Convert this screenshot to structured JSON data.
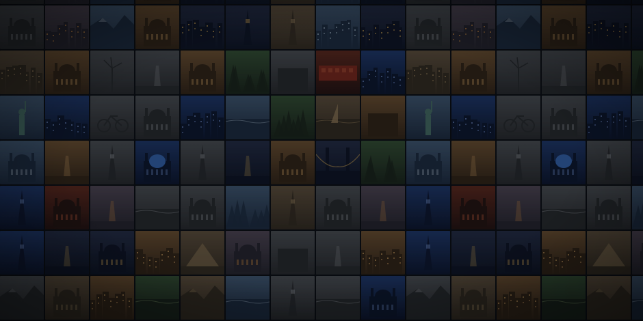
{
  "mosaic": {
    "columns": 15,
    "palette": {
      "night": [
        "#10182b",
        "#2a3350",
        "#c9a25a"
      ],
      "dusk": [
        "#2b2a35",
        "#5a5060",
        "#c88a4a"
      ],
      "sepia": [
        "#3b3227",
        "#6b5a45",
        "#a08660"
      ],
      "sky": [
        "#22324a",
        "#4a6482",
        "#9fb3c8"
      ],
      "grey": [
        "#2e3034",
        "#55595f",
        "#8c9096"
      ],
      "warm": [
        "#3a2a1c",
        "#7a5a38",
        "#d0a060"
      ],
      "green": [
        "#1e2a20",
        "#3c5a3c",
        "#7f9a6a"
      ],
      "blue": [
        "#0f1a36",
        "#24407a",
        "#6a8ac8"
      ],
      "red": [
        "#2a1614",
        "#6a2e22",
        "#c0583a"
      ]
    },
    "rows": [
      [
        {
          "subject": "dome",
          "tone": "grey"
        },
        {
          "subject": "harbor-night",
          "tone": "dusk"
        },
        {
          "subject": "mountains",
          "tone": "sky"
        },
        {
          "subject": "cathedral-night",
          "tone": "warm"
        },
        {
          "subject": "city-lights",
          "tone": "night"
        },
        {
          "subject": "tower-night",
          "tone": "night"
        },
        {
          "subject": "eiffel-tower",
          "tone": "sepia"
        },
        {
          "subject": "cloud-city",
          "tone": "sky"
        },
        {
          "subject": "canal-night",
          "tone": "night"
        },
        {
          "subject": "dome",
          "tone": "grey"
        },
        {
          "subject": "harbor-night",
          "tone": "dusk"
        },
        {
          "subject": "mountains",
          "tone": "sky"
        },
        {
          "subject": "cathedral-night",
          "tone": "warm"
        },
        {
          "subject": "city-lights",
          "tone": "night"
        },
        {
          "subject": "tower-night",
          "tone": "night"
        }
      ],
      [
        {
          "subject": "dome",
          "tone": "grey"
        },
        {
          "subject": "harbor-night",
          "tone": "dusk"
        },
        {
          "subject": "mountains",
          "tone": "sky"
        },
        {
          "subject": "cathedral-night",
          "tone": "warm"
        },
        {
          "subject": "city-lights",
          "tone": "night"
        },
        {
          "subject": "tower-night",
          "tone": "night"
        },
        {
          "subject": "eiffel-tower",
          "tone": "sepia"
        },
        {
          "subject": "cloud-city",
          "tone": "sky"
        },
        {
          "subject": "canal-night",
          "tone": "night"
        },
        {
          "subject": "dome",
          "tone": "grey"
        },
        {
          "subject": "harbor-night",
          "tone": "dusk"
        },
        {
          "subject": "mountains",
          "tone": "sky"
        },
        {
          "subject": "cathedral-night",
          "tone": "warm"
        },
        {
          "subject": "city-lights",
          "tone": "night"
        },
        {
          "subject": "tower-night",
          "tone": "night"
        }
      ],
      [
        {
          "subject": "old-town",
          "tone": "sepia"
        },
        {
          "subject": "bridge-arch",
          "tone": "warm"
        },
        {
          "subject": "windmill",
          "tone": "grey"
        },
        {
          "subject": "spiral-street",
          "tone": "grey"
        },
        {
          "subject": "brandenburg-gate",
          "tone": "warm"
        },
        {
          "subject": "forest-lake",
          "tone": "green"
        },
        {
          "subject": "white-building",
          "tone": "grey"
        },
        {
          "subject": "train",
          "tone": "red"
        },
        {
          "subject": "river-city",
          "tone": "blue"
        },
        {
          "subject": "old-town",
          "tone": "sepia"
        },
        {
          "subject": "bridge-arch",
          "tone": "warm"
        },
        {
          "subject": "windmill",
          "tone": "grey"
        },
        {
          "subject": "spiral-street",
          "tone": "grey"
        },
        {
          "subject": "brandenburg-gate",
          "tone": "warm"
        },
        {
          "subject": "forest-lake",
          "tone": "green"
        }
      ],
      [
        {
          "subject": "statue-of-liberty",
          "tone": "sky"
        },
        {
          "subject": "plaza",
          "tone": "blue"
        },
        {
          "subject": "bicycle",
          "tone": "grey"
        },
        {
          "subject": "gothic-cathedral",
          "tone": "grey"
        },
        {
          "subject": "crowd",
          "tone": "blue"
        },
        {
          "subject": "beach-wave",
          "tone": "sky"
        },
        {
          "subject": "palm-tree",
          "tone": "green"
        },
        {
          "subject": "sailboat",
          "tone": "sepia"
        },
        {
          "subject": "skyscrapers",
          "tone": "warm"
        },
        {
          "subject": "statue-of-liberty",
          "tone": "sky"
        },
        {
          "subject": "plaza",
          "tone": "blue"
        },
        {
          "subject": "bicycle",
          "tone": "grey"
        },
        {
          "subject": "gothic-cathedral",
          "tone": "grey"
        },
        {
          "subject": "crowd",
          "tone": "blue"
        },
        {
          "subject": "beach-wave",
          "tone": "sky"
        }
      ],
      [
        {
          "subject": "mosque",
          "tone": "sky"
        },
        {
          "subject": "tunnel",
          "tone": "warm"
        },
        {
          "subject": "clock-tower",
          "tone": "grey"
        },
        {
          "subject": "blue-dome",
          "tone": "blue"
        },
        {
          "subject": "big-ben",
          "tone": "grey"
        },
        {
          "subject": "night-road",
          "tone": "night"
        },
        {
          "subject": "golden-church",
          "tone": "warm"
        },
        {
          "subject": "lit-bridge",
          "tone": "night"
        },
        {
          "subject": "jungle",
          "tone": "green"
        },
        {
          "subject": "mosque",
          "tone": "sky"
        },
        {
          "subject": "tunnel",
          "tone": "warm"
        },
        {
          "subject": "clock-tower",
          "tone": "grey"
        },
        {
          "subject": "blue-dome",
          "tone": "blue"
        },
        {
          "subject": "big-ben",
          "tone": "grey"
        },
        {
          "subject": "night-road",
          "tone": "night"
        }
      ],
      [
        {
          "subject": "tower-bridge",
          "tone": "blue"
        },
        {
          "subject": "golden-gate",
          "tone": "red"
        },
        {
          "subject": "dark-street",
          "tone": "dusk"
        },
        {
          "subject": "pier",
          "tone": "grey"
        },
        {
          "subject": "palace",
          "tone": "grey"
        },
        {
          "subject": "snow-trees",
          "tone": "sky"
        },
        {
          "subject": "lifeguard-tower",
          "tone": "sepia"
        },
        {
          "subject": "milan-cathedral",
          "tone": "grey"
        },
        {
          "subject": "desert-road",
          "tone": "dusk"
        },
        {
          "subject": "tower-bridge",
          "tone": "blue"
        },
        {
          "subject": "golden-gate",
          "tone": "red"
        },
        {
          "subject": "dark-street",
          "tone": "dusk"
        },
        {
          "subject": "pier",
          "tone": "grey"
        },
        {
          "subject": "palace",
          "tone": "grey"
        },
        {
          "subject": "snow-trees",
          "tone": "sky"
        }
      ],
      [
        {
          "subject": "blue-towers",
          "tone": "blue"
        },
        {
          "subject": "street-lamp",
          "tone": "night"
        },
        {
          "subject": "berlin-dome",
          "tone": "night"
        },
        {
          "subject": "lit-city",
          "tone": "warm"
        },
        {
          "subject": "pyramid",
          "tone": "sepia"
        },
        {
          "subject": "arch-building",
          "tone": "dusk"
        },
        {
          "subject": "stone-path",
          "tone": "grey"
        },
        {
          "subject": "railway",
          "tone": "grey"
        },
        {
          "subject": "colorful-houses",
          "tone": "warm"
        },
        {
          "subject": "blue-towers",
          "tone": "blue"
        },
        {
          "subject": "street-lamp",
          "tone": "night"
        },
        {
          "subject": "berlin-dome",
          "tone": "night"
        },
        {
          "subject": "lit-city",
          "tone": "warm"
        },
        {
          "subject": "pyramid",
          "tone": "sepia"
        },
        {
          "subject": "arch-building",
          "tone": "dusk"
        }
      ],
      [
        {
          "subject": "waterfall-cliff",
          "tone": "grey"
        },
        {
          "subject": "town-hall",
          "tone": "sepia"
        },
        {
          "subject": "hillside-town",
          "tone": "warm"
        },
        {
          "subject": "sea-horizon",
          "tone": "green"
        },
        {
          "subject": "rock-climber",
          "tone": "sepia"
        },
        {
          "subject": "coast-village",
          "tone": "sky"
        },
        {
          "subject": "tv-tower",
          "tone": "grey"
        },
        {
          "subject": "dark-wave",
          "tone": "grey"
        },
        {
          "subject": "arc-de-triomphe",
          "tone": "blue"
        },
        {
          "subject": "waterfall-cliff",
          "tone": "grey"
        },
        {
          "subject": "town-hall",
          "tone": "sepia"
        },
        {
          "subject": "hillside-town",
          "tone": "warm"
        },
        {
          "subject": "sea-horizon",
          "tone": "green"
        },
        {
          "subject": "rock-climber",
          "tone": "sepia"
        },
        {
          "subject": "coast-village",
          "tone": "sky"
        }
      ]
    ]
  }
}
